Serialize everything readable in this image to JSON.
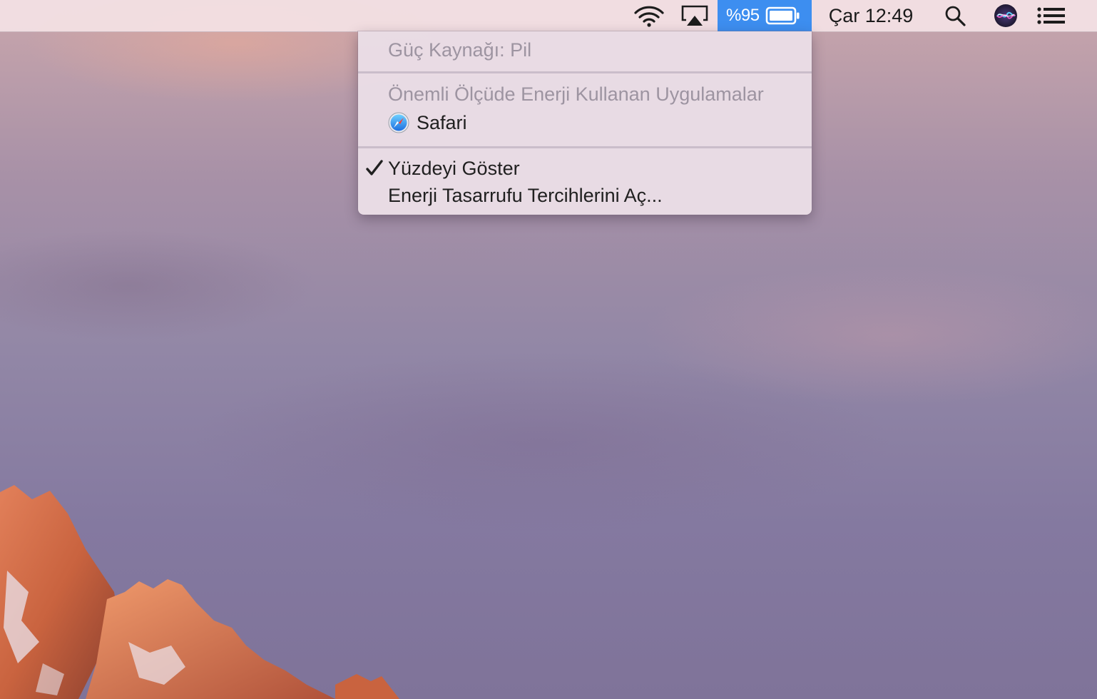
{
  "menubar": {
    "battery_percent": "%95",
    "clock": "Çar 12:49",
    "accent_color": "#3d8ef0",
    "icons": [
      "wifi-icon",
      "airplay-icon",
      "battery-icon",
      "search-icon",
      "siri-icon",
      "notification-center-icon"
    ]
  },
  "battery_menu": {
    "power_source": "Güç Kaynağı: Pil",
    "apps_heading": "Önemli Ölçüde Enerji Kullanan Uygulamalar",
    "apps": [
      {
        "name": "Safari",
        "icon": "safari-icon"
      }
    ],
    "show_percentage": {
      "label": "Yüzdeyi Göster",
      "checked": true
    },
    "energy_prefs": "Enerji Tasarrufu Tercihlerini Aç..."
  }
}
